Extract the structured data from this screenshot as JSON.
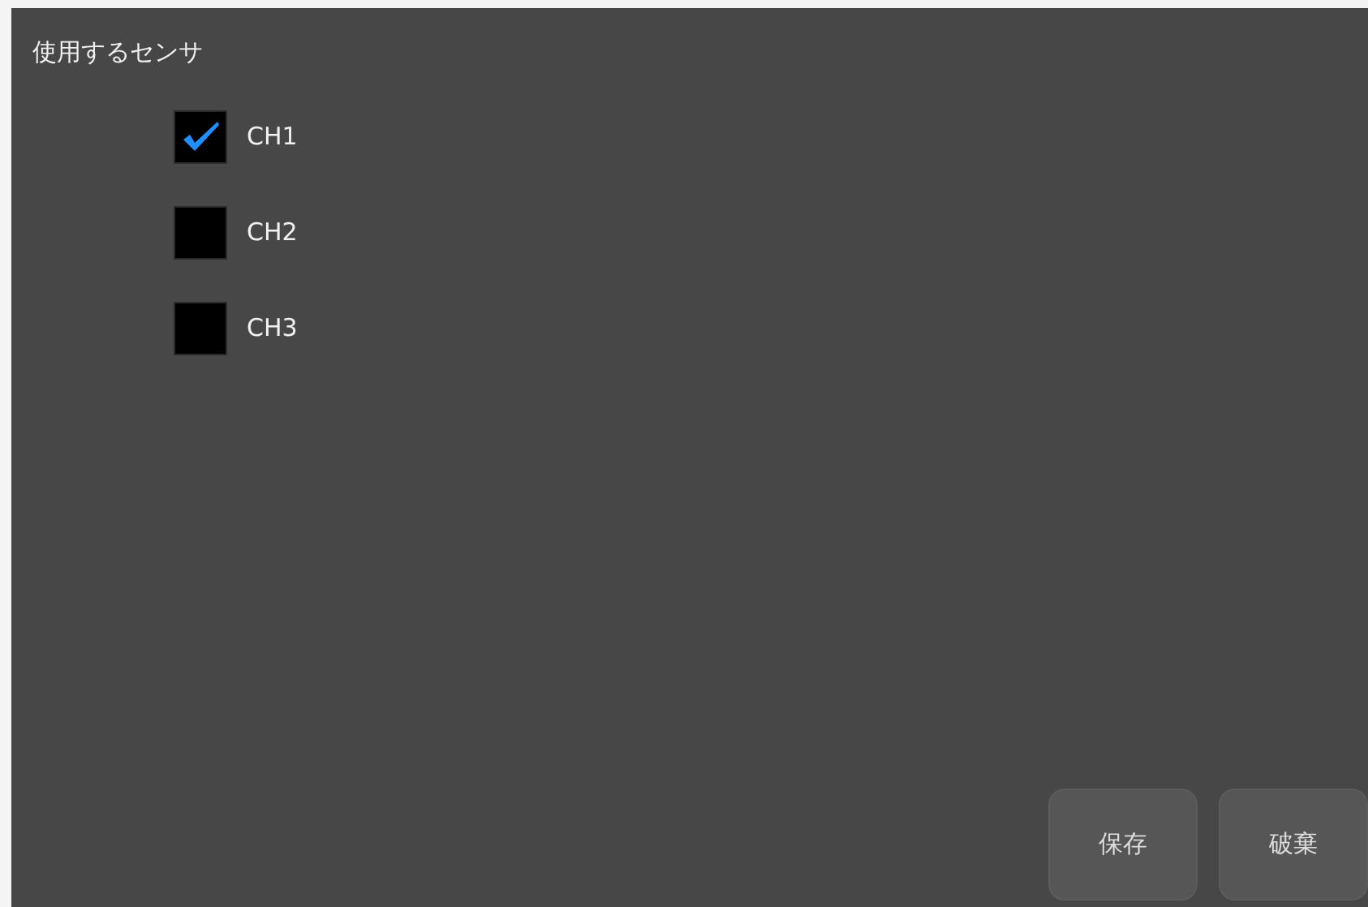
{
  "title": "使用するセンサ",
  "sensors": [
    {
      "label": "CH1",
      "checked": true
    },
    {
      "label": "CH2",
      "checked": false
    },
    {
      "label": "CH3",
      "checked": false
    }
  ],
  "buttons": [
    "保存",
    "破棄"
  ]
}
